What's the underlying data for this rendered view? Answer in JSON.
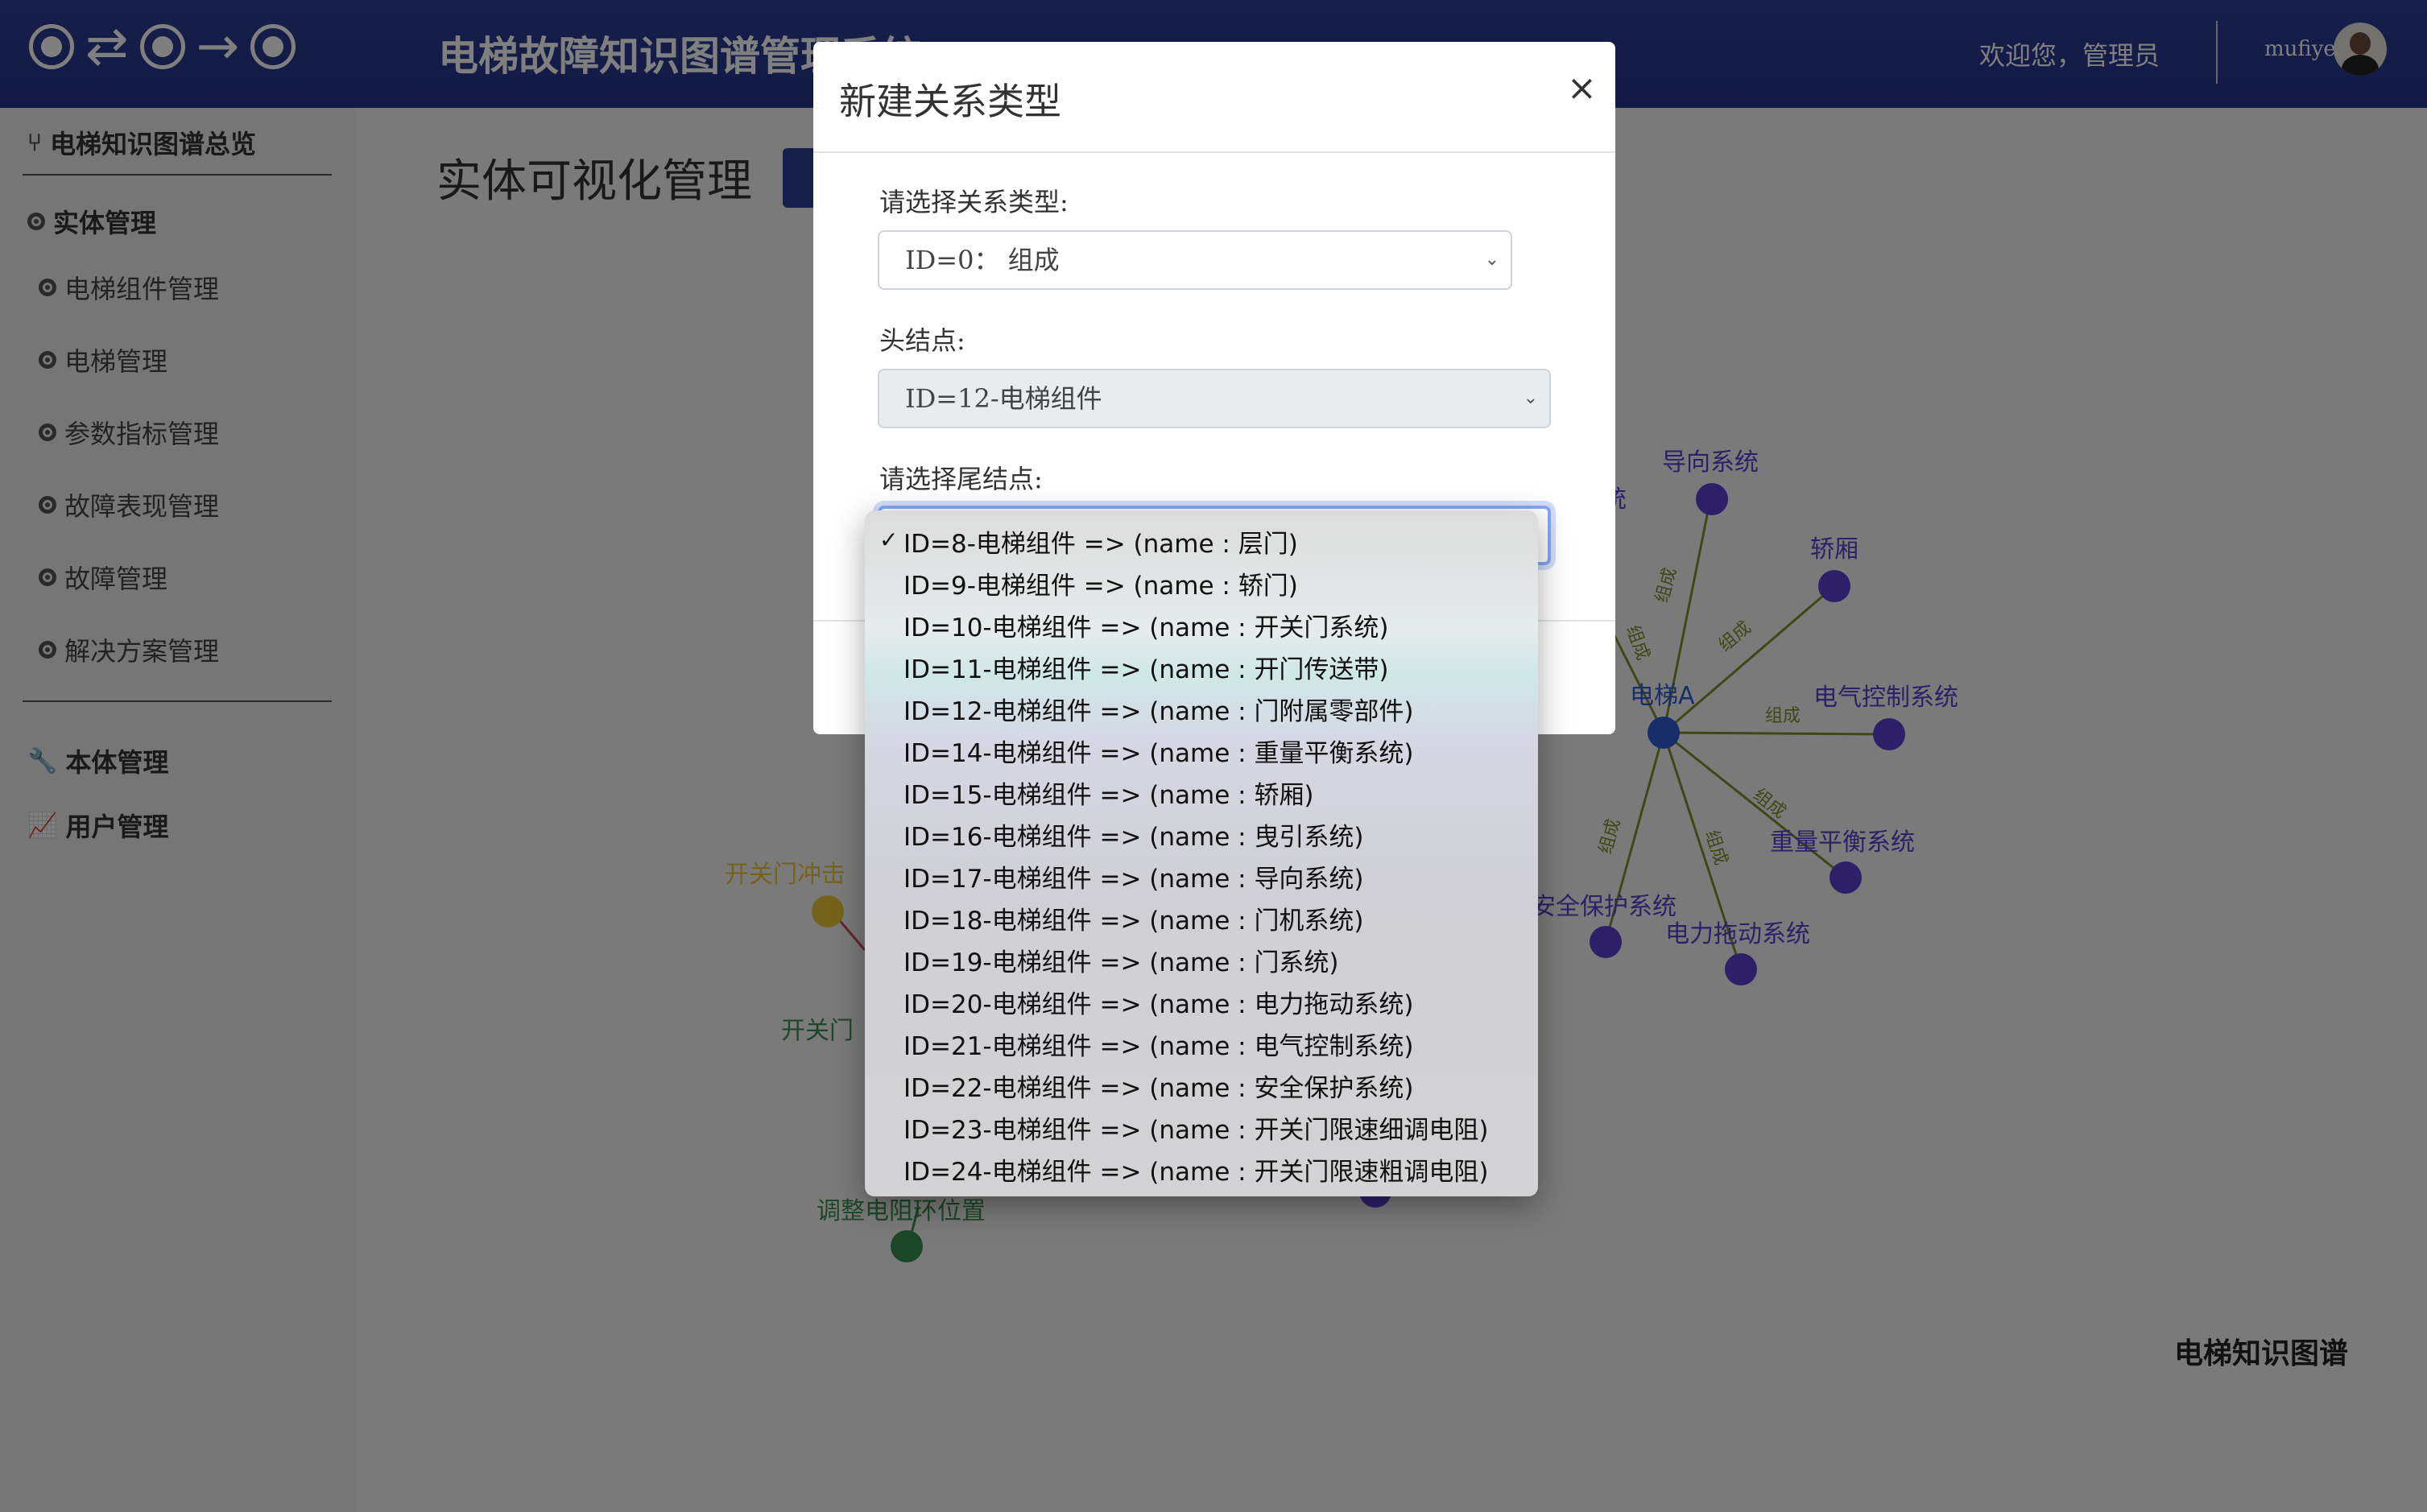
{
  "header": {
    "app_title": "电梯故障知识图谱管理系统",
    "welcome": "欢迎您，管理员",
    "username": "mufiye"
  },
  "sidebar": {
    "overview": "电梯知识图谱总览",
    "entity_group": "实体管理",
    "entity_items": [
      "电梯组件管理",
      "电梯管理",
      "参数指标管理",
      "故障表现管理",
      "故障管理",
      "解决方案管理"
    ],
    "ontology": "本体管理",
    "users": "用户管理"
  },
  "main": {
    "page_title": "实体可视化管理",
    "graph_title": "电梯知识图谱"
  },
  "graph": {
    "colors": {
      "component": "#5b3fd0",
      "hub": "#2f5dd6",
      "edge": "#7f8f2a",
      "fault": "#e9c635",
      "solution": "#3a8f52"
    },
    "hub_label": "电梯A",
    "nodes": [
      "导向系统",
      "轿厢",
      "电气控制系统",
      "重量平衡系统",
      "电力拖动系统",
      "安全保护系统",
      "开关门冲击",
      "开关门",
      "调整电阻环位置",
      "统"
    ],
    "edge_label": "组成"
  },
  "modal": {
    "title": "新建关系类型",
    "close": "×",
    "relation_label": "请选择关系类型:",
    "relation_value": "ID=0： 组成",
    "head_label": "头结点:",
    "head_value": "ID=12-电梯组件",
    "tail_label": "请选择尾结点:"
  },
  "dropdown": {
    "selected_index": 0,
    "checkmark": "✓",
    "options": [
      "ID=8-电梯组件 => (name : 层门)",
      "ID=9-电梯组件 => (name : 轿门)",
      "ID=10-电梯组件 => (name : 开关门系统)",
      "ID=11-电梯组件 => (name : 开门传送带)",
      "ID=12-电梯组件 => (name : 门附属零部件)",
      "ID=14-电梯组件 => (name : 重量平衡系统)",
      "ID=15-电梯组件 => (name : 轿厢)",
      "ID=16-电梯组件 => (name : 曳引系统)",
      "ID=17-电梯组件 => (name : 导向系统)",
      "ID=18-电梯组件 => (name : 门机系统)",
      "ID=19-电梯组件 => (name : 门系统)",
      "ID=20-电梯组件 => (name : 电力拖动系统)",
      "ID=21-电梯组件 => (name : 电气控制系统)",
      "ID=22-电梯组件 => (name : 安全保护系统)",
      "ID=23-电梯组件 => (name : 开关门限速细调电阻)",
      "ID=24-电梯组件 => (name : 开关门限速粗调电阻)"
    ]
  }
}
